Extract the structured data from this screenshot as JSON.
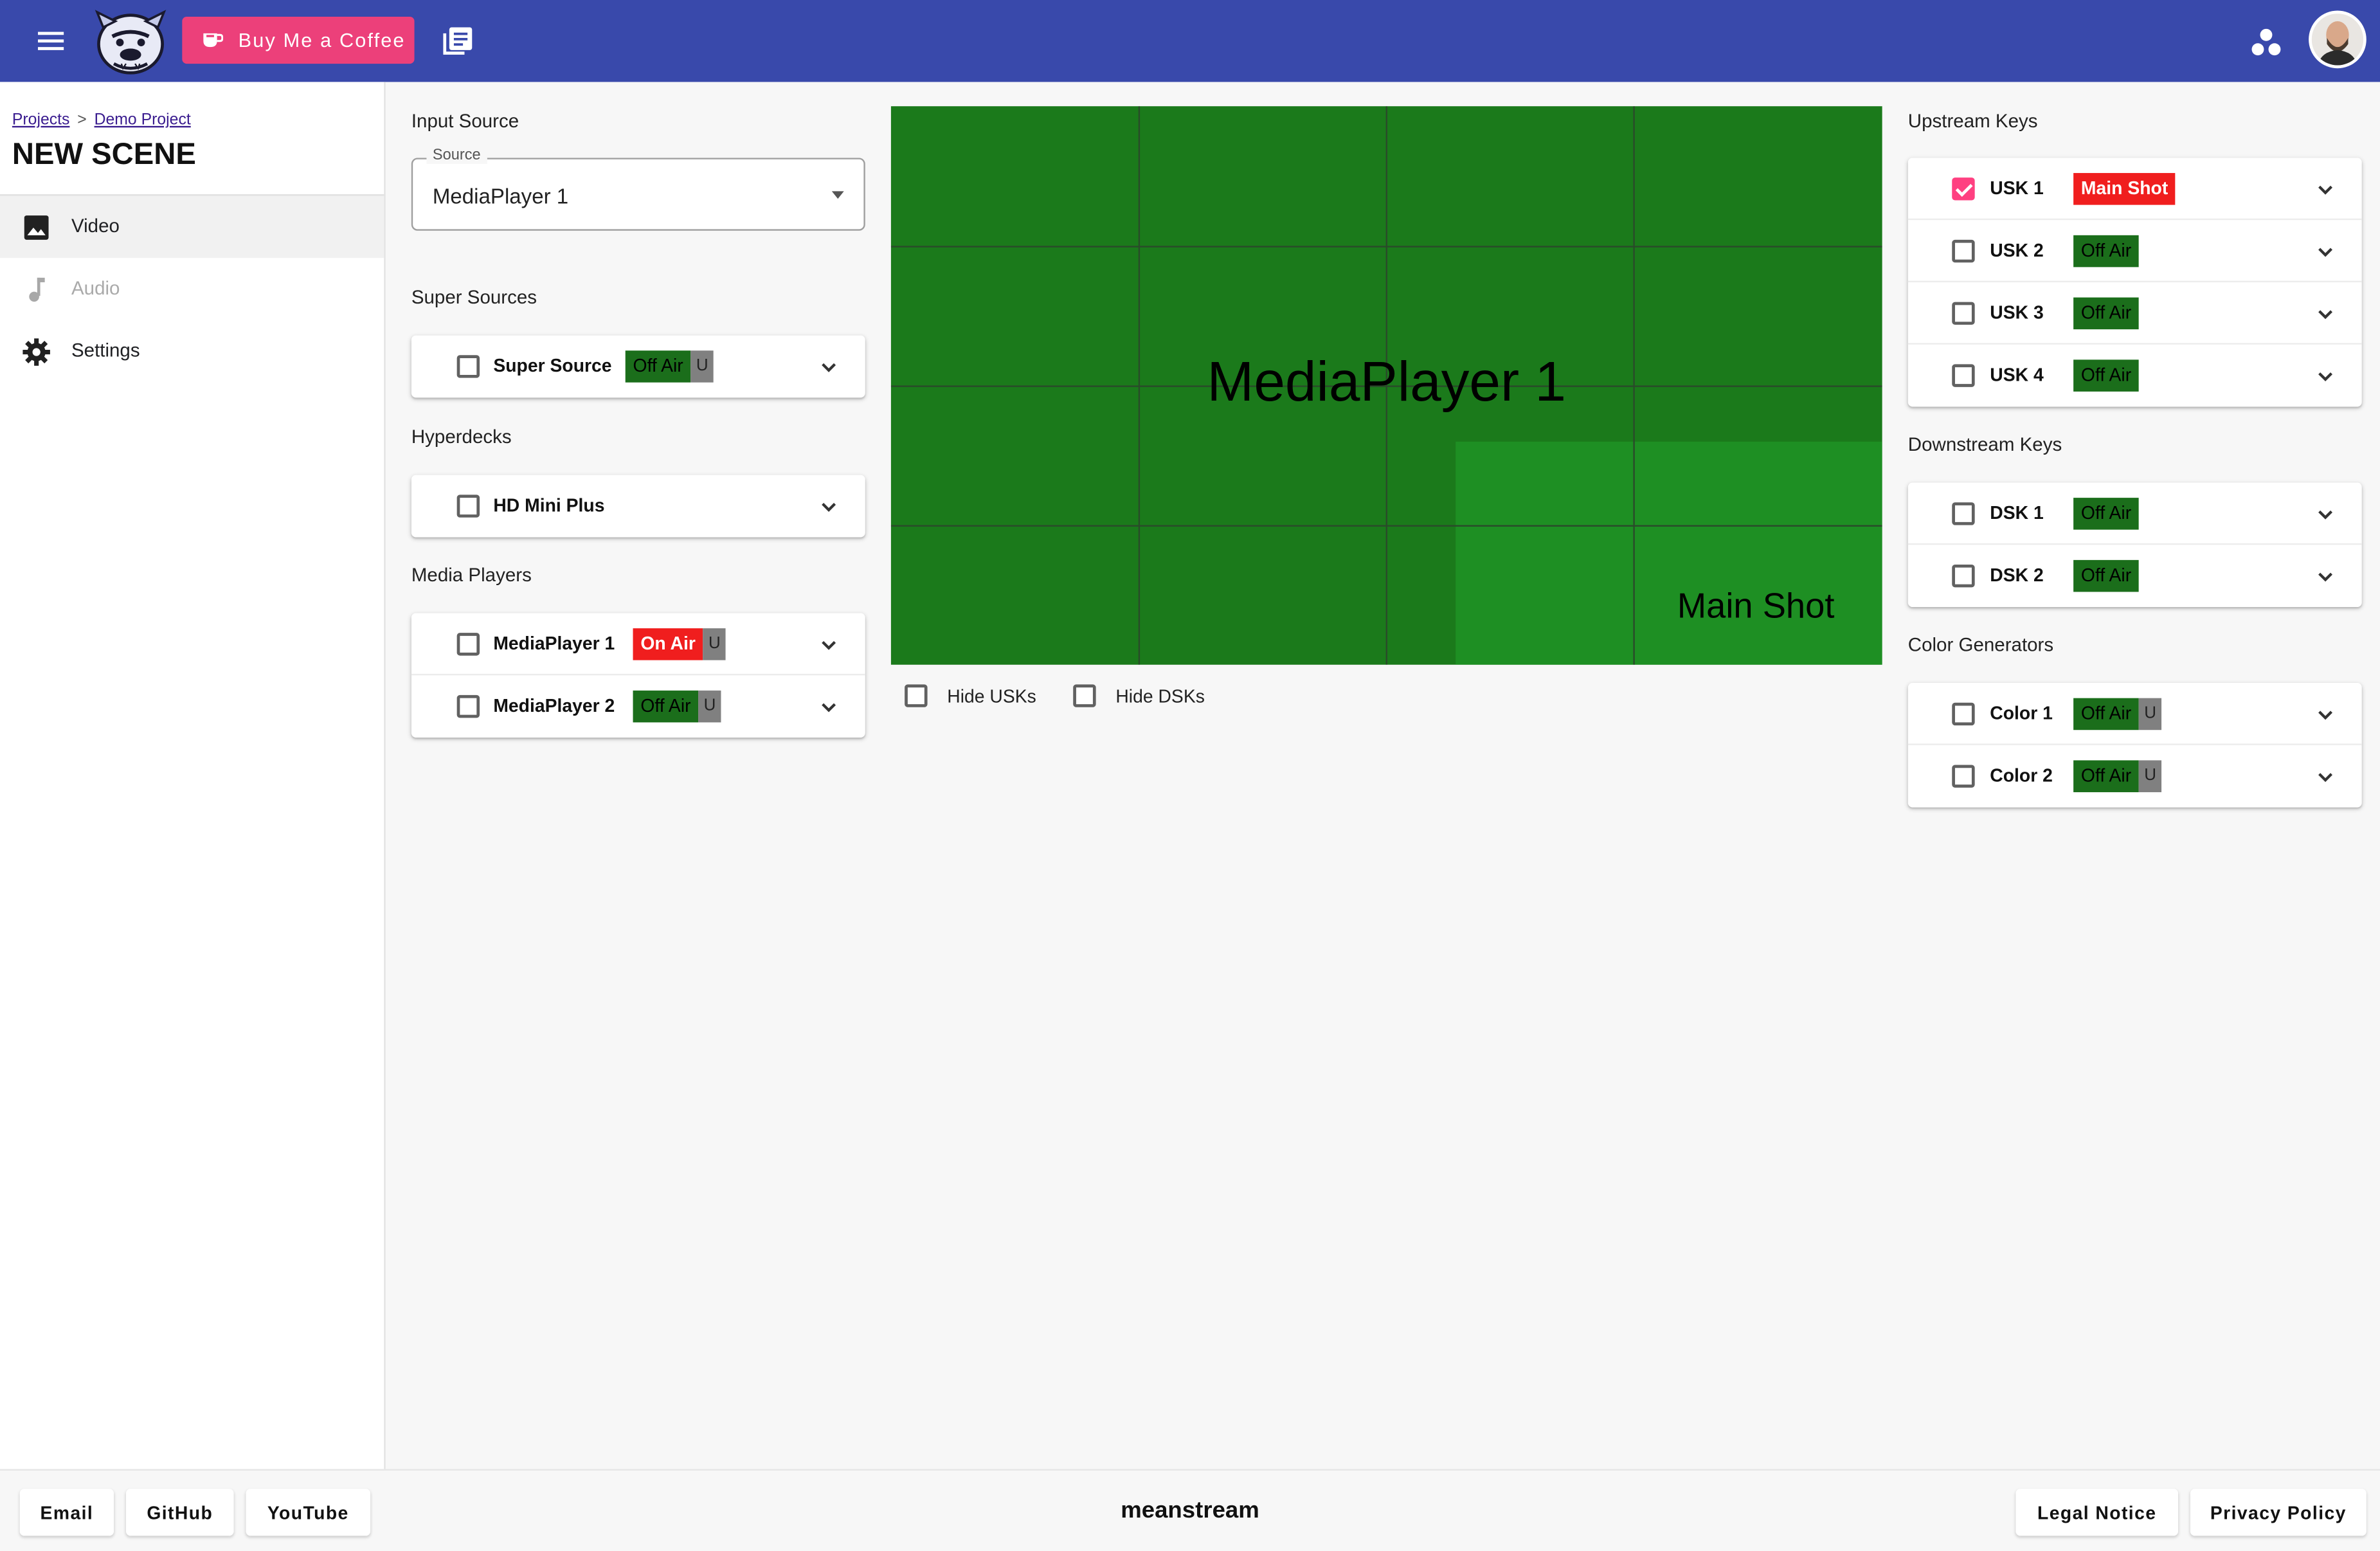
{
  "header": {
    "coffee_label": "Buy Me a Coffee"
  },
  "sidebar": {
    "breadcrumb": [
      "Projects",
      "Demo Project"
    ],
    "breadcrumb_sep": ">",
    "scene_title": "NEW SCENE",
    "items": [
      {
        "label": "Video",
        "icon": "image-icon",
        "active": true
      },
      {
        "label": "Audio",
        "icon": "music-note-icon",
        "disabled": true
      },
      {
        "label": "Settings",
        "icon": "gear-icon"
      }
    ]
  },
  "input_source": {
    "heading": "Input Source",
    "field_label": "Source",
    "value": "MediaPlayer 1"
  },
  "super_sources": {
    "heading": "Super Sources",
    "items": [
      {
        "label": "Super Source",
        "status": "Off Air",
        "u": "U",
        "checked": false
      }
    ]
  },
  "hyperdecks": {
    "heading": "Hyperdecks",
    "items": [
      {
        "label": "HD Mini Plus",
        "checked": false
      }
    ]
  },
  "media_players": {
    "heading": "Media Players",
    "items": [
      {
        "label": "MediaPlayer 1",
        "status": "On Air",
        "u": "U",
        "checked": false
      },
      {
        "label": "MediaPlayer 2",
        "status": "Off Air",
        "u": "U",
        "checked": false
      }
    ]
  },
  "preview": {
    "title": "MediaPlayer 1",
    "usk_label": "Main Shot",
    "hide_usks": "Hide USKs",
    "hide_dsks": "Hide DSKs",
    "bg_color": "#1b7a1b",
    "usk_color": "#1e8f23"
  },
  "upstream_keys": {
    "heading": "Upstream Keys",
    "items": [
      {
        "label": "USK 1",
        "status": "Main Shot",
        "checked": true
      },
      {
        "label": "USK 2",
        "status": "Off Air",
        "checked": false
      },
      {
        "label": "USK 3",
        "status": "Off Air",
        "checked": false
      },
      {
        "label": "USK 4",
        "status": "Off Air",
        "checked": false
      }
    ]
  },
  "downstream_keys": {
    "heading": "Downstream Keys",
    "items": [
      {
        "label": "DSK 1",
        "status": "Off Air",
        "checked": false
      },
      {
        "label": "DSK 2",
        "status": "Off Air",
        "checked": false
      }
    ]
  },
  "color_generators": {
    "heading": "Color Generators",
    "items": [
      {
        "label": "Color 1",
        "status": "Off Air",
        "u": "U",
        "checked": false
      },
      {
        "label": "Color 2",
        "status": "Off Air",
        "u": "U",
        "checked": false
      }
    ]
  },
  "footer": {
    "email": "Email",
    "github": "GitHub",
    "youtube": "YouTube",
    "brand": "meanstream",
    "legal": "Legal Notice",
    "privacy": "Privacy Policy"
  },
  "colors": {
    "primary": "#3949ab",
    "accent": "#ec407a",
    "checkbox_checked": "#ff4081",
    "on_air": "#f01e1e",
    "off_air": "#1b6e1b"
  }
}
